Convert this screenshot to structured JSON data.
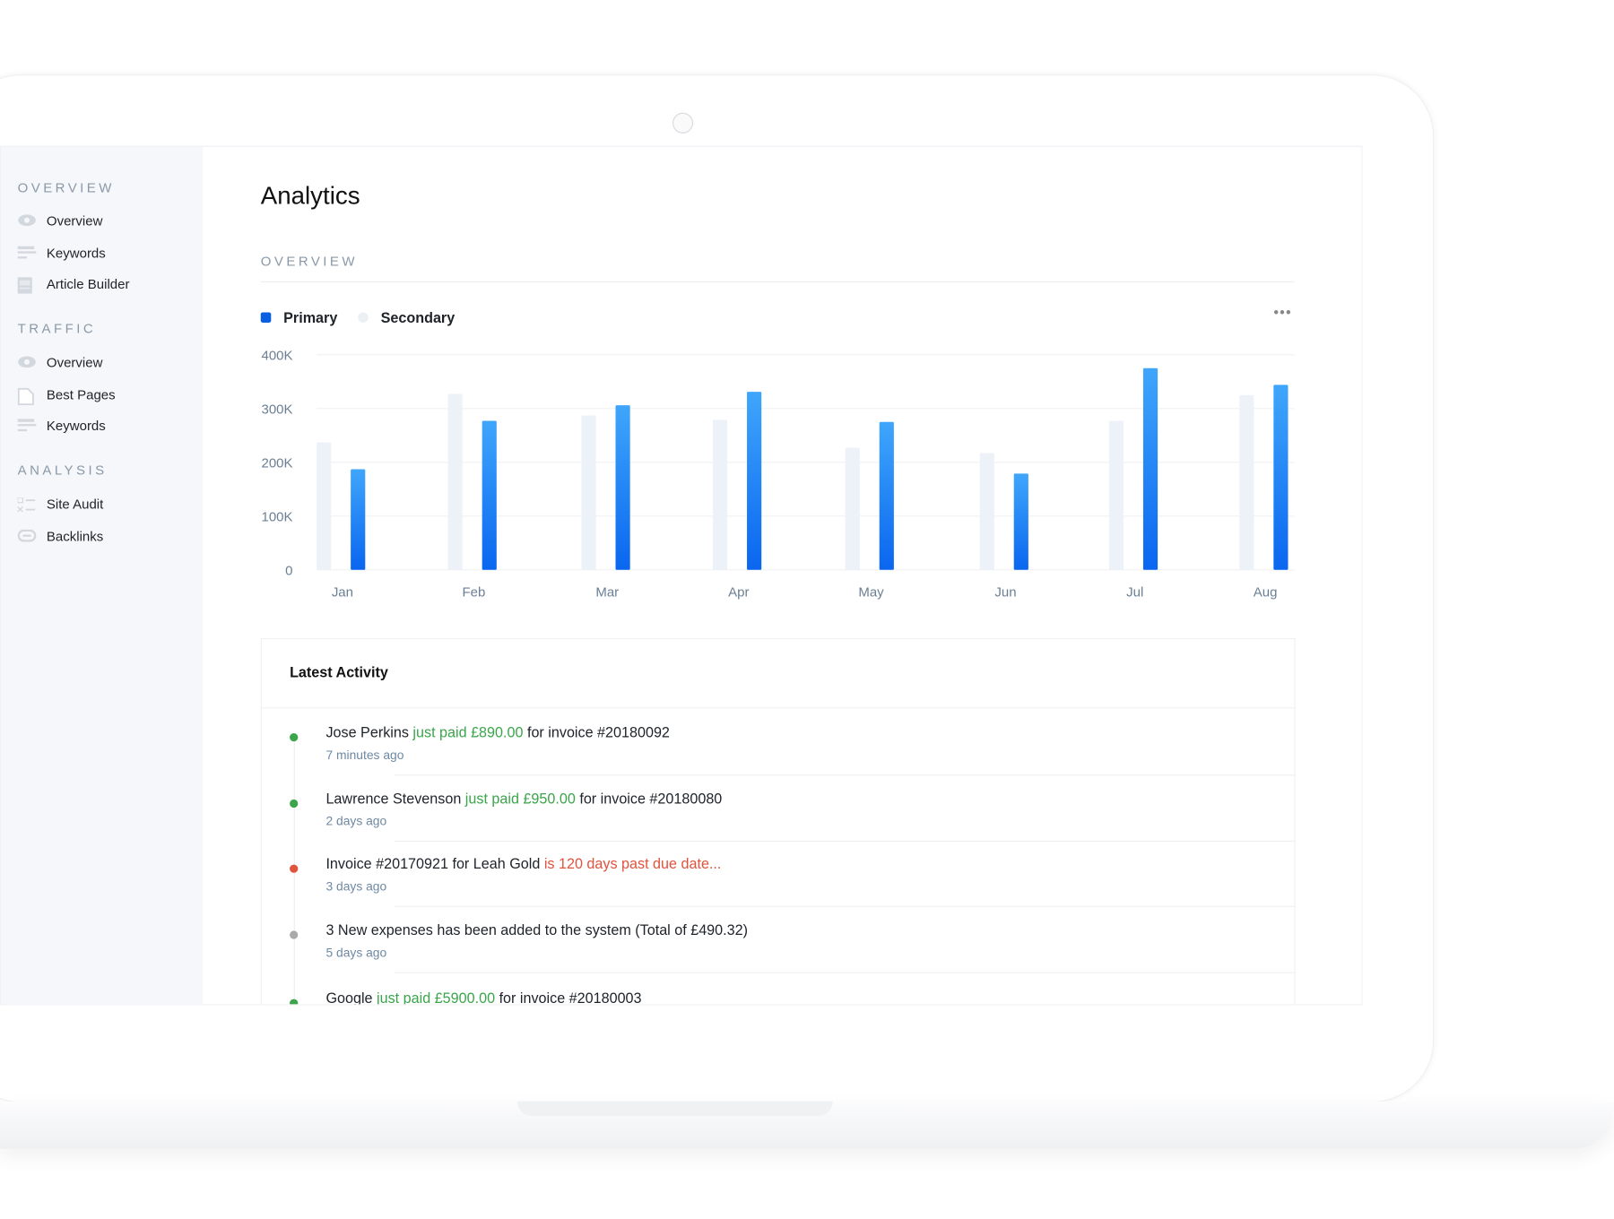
{
  "sidebar": {
    "sections": [
      {
        "title": "OVERVIEW",
        "items": [
          {
            "label": "Overview",
            "icon": "eye-icon"
          },
          {
            "label": "Keywords",
            "icon": "lines-icon"
          },
          {
            "label": "Article Builder",
            "icon": "document-icon"
          }
        ]
      },
      {
        "title": "TRAFFIC",
        "items": [
          {
            "label": "Overview",
            "icon": "eye-icon"
          },
          {
            "label": "Best Pages",
            "icon": "page-icon"
          },
          {
            "label": "Keywords",
            "icon": "lines-icon"
          }
        ]
      },
      {
        "title": "ANALYSIS",
        "items": [
          {
            "label": "Site Audit",
            "icon": "checklist-icon"
          },
          {
            "label": "Backlinks",
            "icon": "link-icon"
          }
        ]
      }
    ]
  },
  "main": {
    "title": "Analytics",
    "section_label": "OVERVIEW",
    "more_icon": "ellipsis-icon"
  },
  "colors": {
    "primary": "#0a66f0",
    "primary_top": "#3fa6fb",
    "secondary": "#edf2f9",
    "green": "#3aa54a",
    "red": "#e0533d",
    "grey": "#a9a9a9"
  },
  "chart_data": {
    "type": "bar",
    "categories": [
      "Jan",
      "Feb",
      "Mar",
      "Apr",
      "May",
      "Jun",
      "Jul",
      "Aug"
    ],
    "series": [
      {
        "name": "Primary",
        "values": [
          187000,
          277000,
          306000,
          331000,
          275000,
          179000,
          375000,
          344000
        ]
      },
      {
        "name": "Secondary",
        "values": [
          237000,
          327000,
          287000,
          279000,
          227000,
          217000,
          277000,
          325000
        ]
      }
    ],
    "yticks": [
      "0",
      "100K",
      "200K",
      "300K",
      "400K"
    ],
    "ylim": [
      0,
      400000
    ],
    "grid": true,
    "legend": "top-left"
  },
  "activity": {
    "title": "Latest Activity",
    "items": [
      {
        "status": "green",
        "pre": "Jose Perkins ",
        "hl": "just paid £890.00",
        "post": " for invoice #20180092",
        "time": "7 minutes ago"
      },
      {
        "status": "green",
        "pre": "Lawrence Stevenson ",
        "hl": "just paid £950.00",
        "post": " for invoice #20180080",
        "time": "2 days ago"
      },
      {
        "status": "red",
        "pre": "Invoice #20170921 for Leah Gold ",
        "hl": "is 120 days past due date...",
        "post": "",
        "time": "3 days ago"
      },
      {
        "status": "grey",
        "pre": "3 New expenses  has been added to the system (Total of £490.32)",
        "hl": "",
        "post": "",
        "time": "5 days ago"
      },
      {
        "status": "green",
        "pre": "Google ",
        "hl": "just paid £5900.00",
        "post": " for invoice #20180003",
        "time": ""
      }
    ]
  }
}
